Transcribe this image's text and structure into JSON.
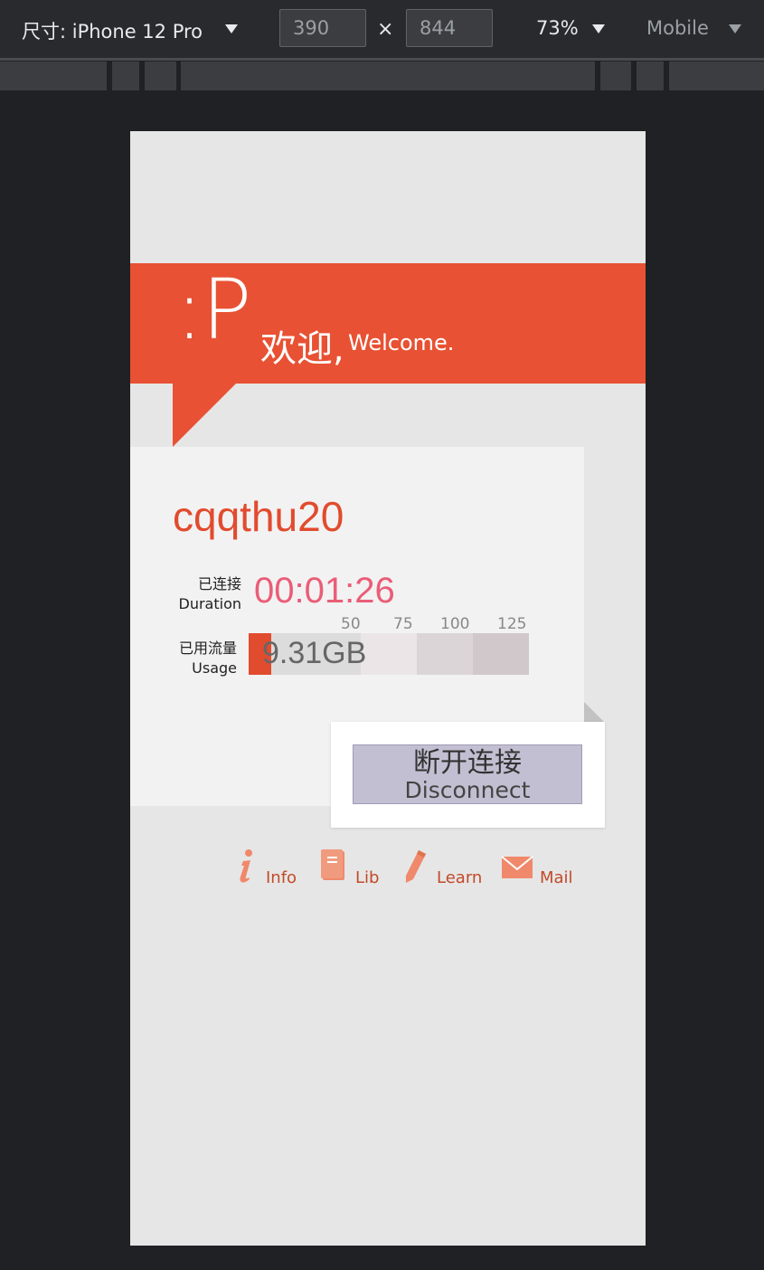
{
  "devtools": {
    "device_label": "尺寸: iPhone 12 Pro",
    "width": "390",
    "height": "844",
    "times": "×",
    "zoom": "73%",
    "mode": "Mobile"
  },
  "banner": {
    "logo": ":P",
    "welcome_cn": "欢迎,",
    "welcome_en": "Welcome."
  },
  "account": {
    "username": "cqqthu20",
    "duration_label_cn": "已连接",
    "duration_label_en": "Duration",
    "duration": "00:01:26",
    "usage_label_cn": "已用流量",
    "usage_label_en": "Usage",
    "usage": "9.31GB",
    "usage_ticks": [
      "50",
      "75",
      "100",
      "125"
    ],
    "usage_fill_fraction": 0.08
  },
  "disconnect": {
    "label_cn": "断开连接",
    "label_en": "Disconnect"
  },
  "nav": [
    {
      "label": "Info",
      "icon": "info-icon"
    },
    {
      "label": "Lib",
      "icon": "book-icon"
    },
    {
      "label": "Learn",
      "icon": "pencil-icon"
    },
    {
      "label": "Mail",
      "icon": "mail-icon"
    }
  ],
  "colors": {
    "brand": "#e85133",
    "username": "#e14b2e",
    "duration": "#ea5d77",
    "icon": "#f0896b",
    "button": "#c3bfd2"
  }
}
